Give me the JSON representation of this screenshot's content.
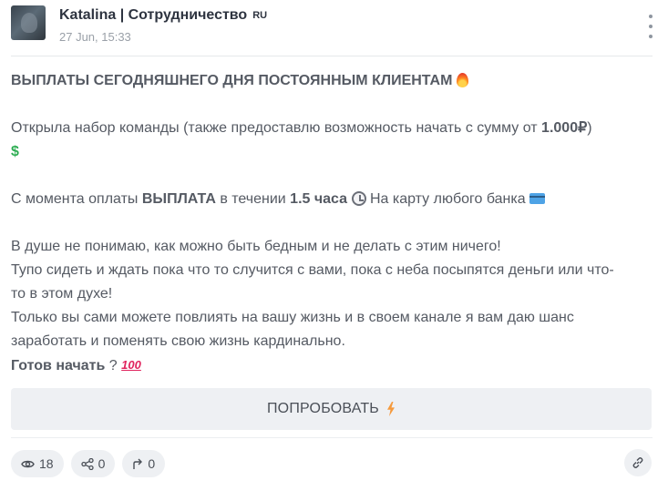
{
  "header": {
    "channel_name": "Katalina | Сотрудничество",
    "lang_badge": "RU",
    "date": "27 Jun, 15:33"
  },
  "post": {
    "title": "ВЫПЛАТЫ СЕГОДНЯШНЕГО ДНЯ ПОСТОЯННЫМ КЛИЕНТАМ",
    "p2_text": "Открыла набор команды (также предоставлю возможность начать с сумму от ",
    "p2_bold": "1.000₽",
    "p2_end": ")",
    "dollar_emoji": "$",
    "p3_a": "С момента оплаты ",
    "p3_b": "ВЫПЛАТА",
    "p3_c": " в течении ",
    "p3_d": "1.5 часа",
    "p3_e": "На карту любого банка",
    "l1": "В душе не понимаю, как можно быть бедным и не делать с этим ничего!",
    "l2": "Тупо сидеть и ждать пока что то случится с вами, пока с неба посыпятся деньги или что-",
    "l3": "то в этом духе!",
    "l4": "Только вы сами можете повлиять на вашу жизнь и в своем канале я вам даю шанс",
    "l5": "заработать и поменять свою жизнь кардинально.",
    "cta_question_bold": "Готов начать",
    "cta_question_mark": " ?",
    "hundred_emoji": "100"
  },
  "cta_button": {
    "label": "ПОПРОБОВАТЬ"
  },
  "stats": {
    "views": "18",
    "shares": "0",
    "forwards": "0"
  },
  "icons": {
    "menu": "more-vertical-icon",
    "eye": "eye-icon",
    "share": "share-icon",
    "forward": "forward-icon",
    "link": "link-icon"
  }
}
